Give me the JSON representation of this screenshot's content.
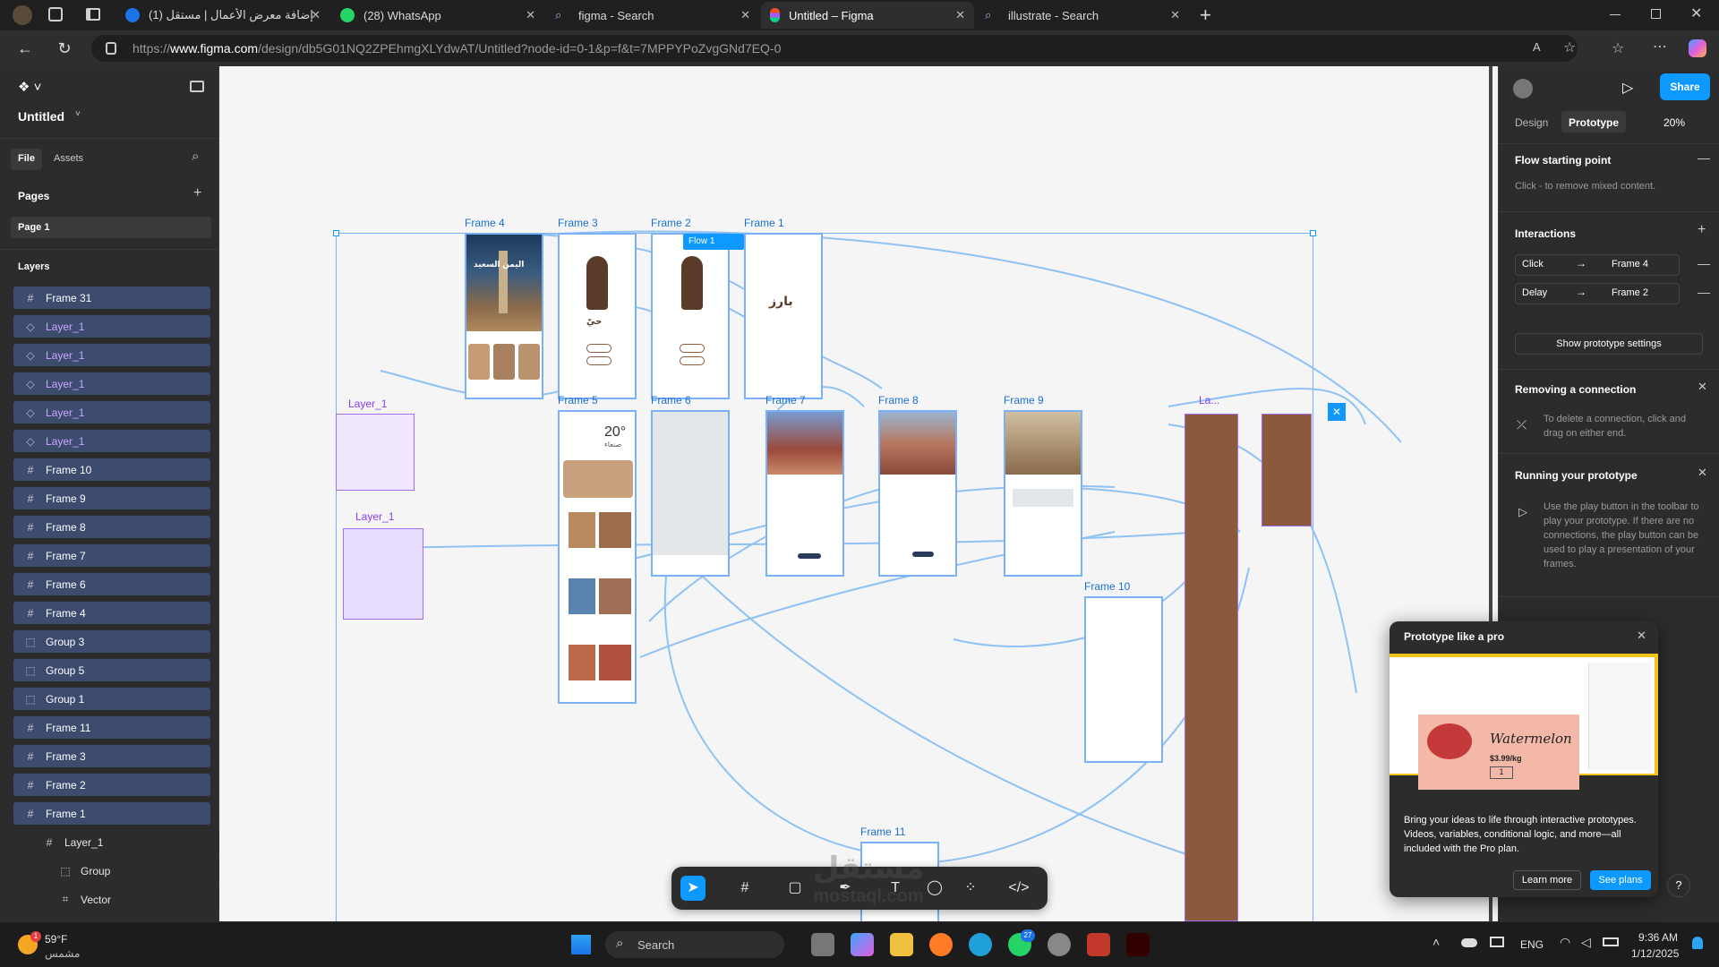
{
  "browser": {
    "tabs": [
      {
        "title": "(1) إضافة معرض الأعمال | مستقل",
        "active": false
      },
      {
        "title": "(28) WhatsApp",
        "active": false
      },
      {
        "title": "figma - Search",
        "active": false
      },
      {
        "title": "Untitled – Figma",
        "active": true
      },
      {
        "title": "illustrate - Search",
        "active": false
      }
    ],
    "new_tab": "+",
    "url_prefix": "https://",
    "url_host": "www.figma.com",
    "url_path": "/design/db5G01NQ2ZPEhmgXLYdwAT/Untitled?node-id=0-1&p=f&t=7MPPYPoZvgGNd7EQ-0"
  },
  "left_panel": {
    "file_name": "Untitled",
    "tabs": {
      "file": "File",
      "assets": "Assets"
    },
    "pages_title": "Pages",
    "page": "Page 1",
    "layers_title": "Layers",
    "layers": [
      {
        "name": "Frame 31",
        "kind": "frame"
      },
      {
        "name": "Layer_1",
        "kind": "component"
      },
      {
        "name": "Layer_1",
        "kind": "component"
      },
      {
        "name": "Layer_1",
        "kind": "component"
      },
      {
        "name": "Layer_1",
        "kind": "component"
      },
      {
        "name": "Layer_1",
        "kind": "component"
      },
      {
        "name": "Frame 10",
        "kind": "frame"
      },
      {
        "name": "Frame 9",
        "kind": "frame"
      },
      {
        "name": "Frame 8",
        "kind": "frame"
      },
      {
        "name": "Frame 7",
        "kind": "frame"
      },
      {
        "name": "Frame 6",
        "kind": "frame"
      },
      {
        "name": "Frame 4",
        "kind": "frame"
      },
      {
        "name": "Group 3",
        "kind": "group"
      },
      {
        "name": "Group 5",
        "kind": "group"
      },
      {
        "name": "Group 1",
        "kind": "group"
      },
      {
        "name": "Frame 11",
        "kind": "frame"
      },
      {
        "name": "Frame 3",
        "kind": "frame"
      },
      {
        "name": "Frame 2",
        "kind": "frame"
      },
      {
        "name": "Frame 1",
        "kind": "frame"
      }
    ],
    "sublayers": [
      {
        "name": "Layer_1",
        "kind": "frame"
      },
      {
        "name": "Group",
        "kind": "group"
      },
      {
        "name": "Vector",
        "kind": "vector"
      }
    ]
  },
  "canvas": {
    "frame_labels": [
      "Frame 4",
      "Frame 3",
      "Frame 2",
      "Frame 1",
      "Frame 5",
      "Frame 6",
      "Frame 7",
      "Frame 8",
      "Frame 9",
      "Frame 10",
      "Frame 11"
    ],
    "layer_labels": [
      "Layer_1",
      "Layer_1",
      "La..."
    ],
    "flow_badge": "Flow 1",
    "frame4_heading": "اليمن السعيد",
    "frame3_title": "حيّ",
    "frame1_logo": "بارز",
    "frame5_temp": "20°",
    "frame5_city": "صنعاء"
  },
  "right_panel": {
    "share": "Share",
    "tabs": {
      "design": "Design",
      "prototype": "Prototype"
    },
    "zoom": "20%",
    "flow_starting_point": "Flow starting point",
    "flow_hint": "Click - to remove mixed content.",
    "interactions_title": "Interactions",
    "interactions": [
      {
        "trigger": "Click",
        "target": "Frame 4"
      },
      {
        "trigger": "Delay",
        "target": "Frame 2"
      }
    ],
    "show_settings": "Show prototype settings",
    "removing_title": "Removing a connection",
    "removing_text": "To delete a connection, click and drag on either end.",
    "running_title": "Running your prototype",
    "running_text": "Use the play button in the toolbar to play your prototype. If there are no connections, the play button can be used to play a presentation of your frames."
  },
  "popup": {
    "title": "Prototype like a pro",
    "image_title": "Watermelon",
    "image_price": "$3.99/kg",
    "image_qty": "1",
    "body": "Bring your ideas to life through interactive prototypes. Videos, variables, conditional logic, and more—all included with the Pro plan.",
    "learn_more": "Learn more",
    "see_plans": "See plans",
    "help": "?"
  },
  "watermark": {
    "line1": "مستقل",
    "line2": "mostaql.com"
  },
  "taskbar": {
    "weather_temp": "59°F",
    "weather_desc": "مشمس",
    "weather_badge": "1",
    "search": "Search",
    "whatsapp_badge": "27",
    "lang": "ENG",
    "time": "9:36 AM",
    "date": "1/12/2025"
  },
  "colors": {
    "figma_blue": "#0d99ff",
    "selection": "#7ab0f7",
    "component_purple": "#8a3df1",
    "brown": "#8b5a3c",
    "layer_highlight": "#3d4b6e"
  }
}
